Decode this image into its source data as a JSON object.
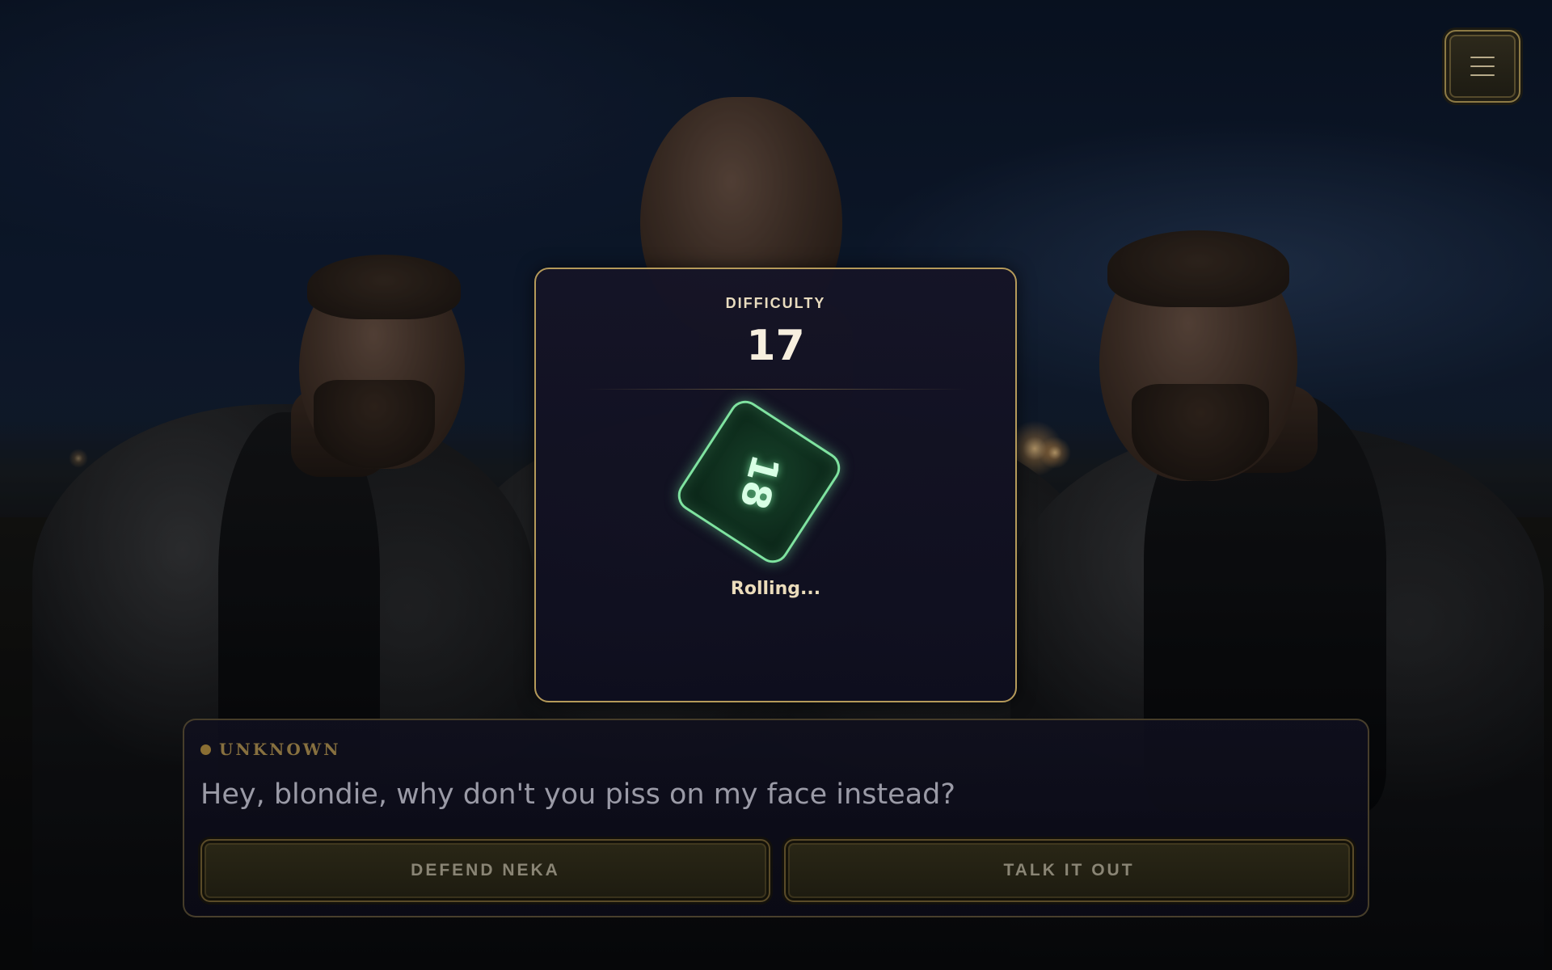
{
  "menu": {
    "icon": "hamburger-menu-icon"
  },
  "roll": {
    "difficulty_label": "DIFFICULTY",
    "difficulty_value": "17",
    "die_value": "18",
    "status": "Rolling..."
  },
  "dialogue": {
    "speaker": "UNKNOWN",
    "text": "Hey, blondie, why don't you piss on my face instead?",
    "choices": [
      {
        "label": "DEFEND NEKA"
      },
      {
        "label": "TALK IT OUT"
      }
    ]
  },
  "colors": {
    "accent_gold": "#b59a5a",
    "die_green": "#7fe3a0",
    "panel_bg": "#151426"
  }
}
